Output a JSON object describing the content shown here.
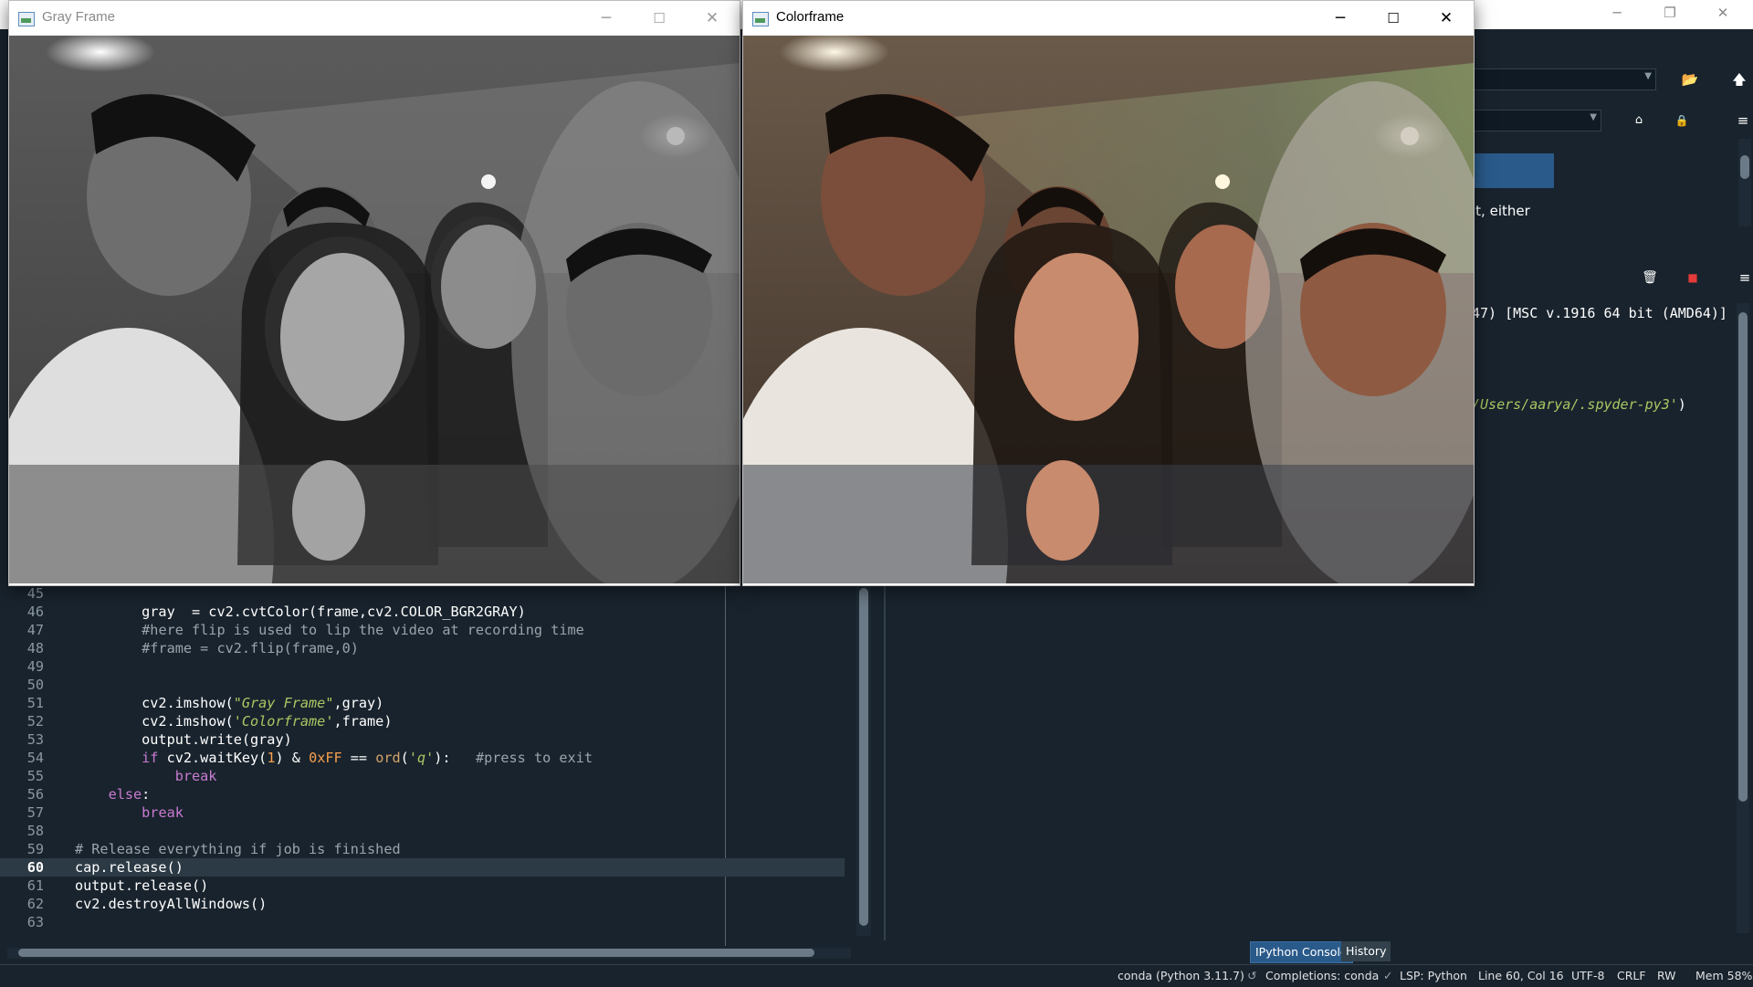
{
  "colors": {
    "ide_bg": "#19232d",
    "accent": "#2a5a8a",
    "comment": "#9ba4ab",
    "string": "#a8c863",
    "keyword": "#c87bd2",
    "number": "#f6a04e"
  },
  "background_ide": {
    "files_pane": {
      "text_snippet": "it, either"
    },
    "editor": {
      "lines": [
        {
          "n": "45",
          "code": ""
        },
        {
          "n": "46",
          "code": "        gray  = cv2.cvtColor(frame,cv2.COLOR_BGR2GRAY)"
        },
        {
          "n": "47",
          "code": "        #here flip is used to lip the video at recording time"
        },
        {
          "n": "48",
          "code": "        #frame = cv2.flip(frame,0)"
        },
        {
          "n": "49",
          "code": ""
        },
        {
          "n": "50",
          "code": ""
        },
        {
          "n": "51",
          "code": "        cv2.imshow(\"Gray Frame\",gray)"
        },
        {
          "n": "52",
          "code": "        cv2.imshow('Colorframe',frame)"
        },
        {
          "n": "53",
          "code": "        output.write(gray)"
        },
        {
          "n": "54",
          "code": "        if cv2.waitKey(1) & 0xFF == ord('q'):   #press to exit"
        },
        {
          "n": "55",
          "code": "            break"
        },
        {
          "n": "56",
          "code": "    else:"
        },
        {
          "n": "57",
          "code": "        break"
        },
        {
          "n": "58",
          "code": ""
        },
        {
          "n": "59",
          "code": "# Release everything if job is finished"
        },
        {
          "n": "60",
          "code": "cap.release()"
        },
        {
          "n": "61",
          "code": "output.release()"
        },
        {
          "n": "62",
          "code": "cv2.destroyAllWindows()"
        },
        {
          "n": "63",
          "code": ""
        }
      ],
      "current_line": "60"
    },
    "console": {
      "line1": "47) [MSC v.1916 64 bit (AMD64)]",
      "line2_path": "/Users/aarya/.spyder-py3'",
      "line2_end": ")"
    },
    "tabs": {
      "ipython": "IPython Console",
      "history": "History"
    },
    "status": {
      "env": "conda (Python 3.11.7)",
      "completions": "Completions: conda",
      "lsp": "LSP: Python",
      "position": "Line 60, Col 16",
      "encoding": "UTF-8",
      "eol": "CRLF",
      "perm": "RW",
      "mem": "Mem 58%"
    }
  },
  "windows": {
    "gray": {
      "title": "Gray Frame"
    },
    "color": {
      "title": "Colorframe"
    }
  },
  "icons": {
    "minimize": "minimize-icon",
    "maximize": "maximize-icon",
    "close": "close-icon",
    "folder": "folder-open-icon",
    "up": "up-arrow-icon",
    "home": "home-icon",
    "lock": "lock-icon",
    "menu": "hamburger-menu-icon",
    "trash": "trash-icon",
    "stop": "stop-icon"
  }
}
